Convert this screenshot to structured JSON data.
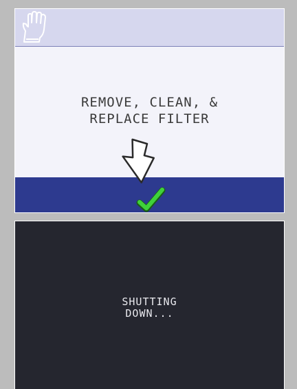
{
  "top_screen": {
    "header_icon": "glove-icon",
    "message_lines": [
      "REMOVE, CLEAN, &",
      "REPLACE FILTER"
    ],
    "confirm_icon": "checkmark-icon",
    "pointer_icon": "arrow-pointer-icon"
  },
  "bottom_screen": {
    "status_lines": [
      "SHUTTING",
      "DOWN..."
    ]
  },
  "colors": {
    "background": "#bcbcbc",
    "header": "#d6d7ee",
    "screen_light": "#f3f3fa",
    "confirm_bar": "#2d3a8f",
    "check_green": "#3fd13a",
    "screen_dark": "#25262f"
  }
}
